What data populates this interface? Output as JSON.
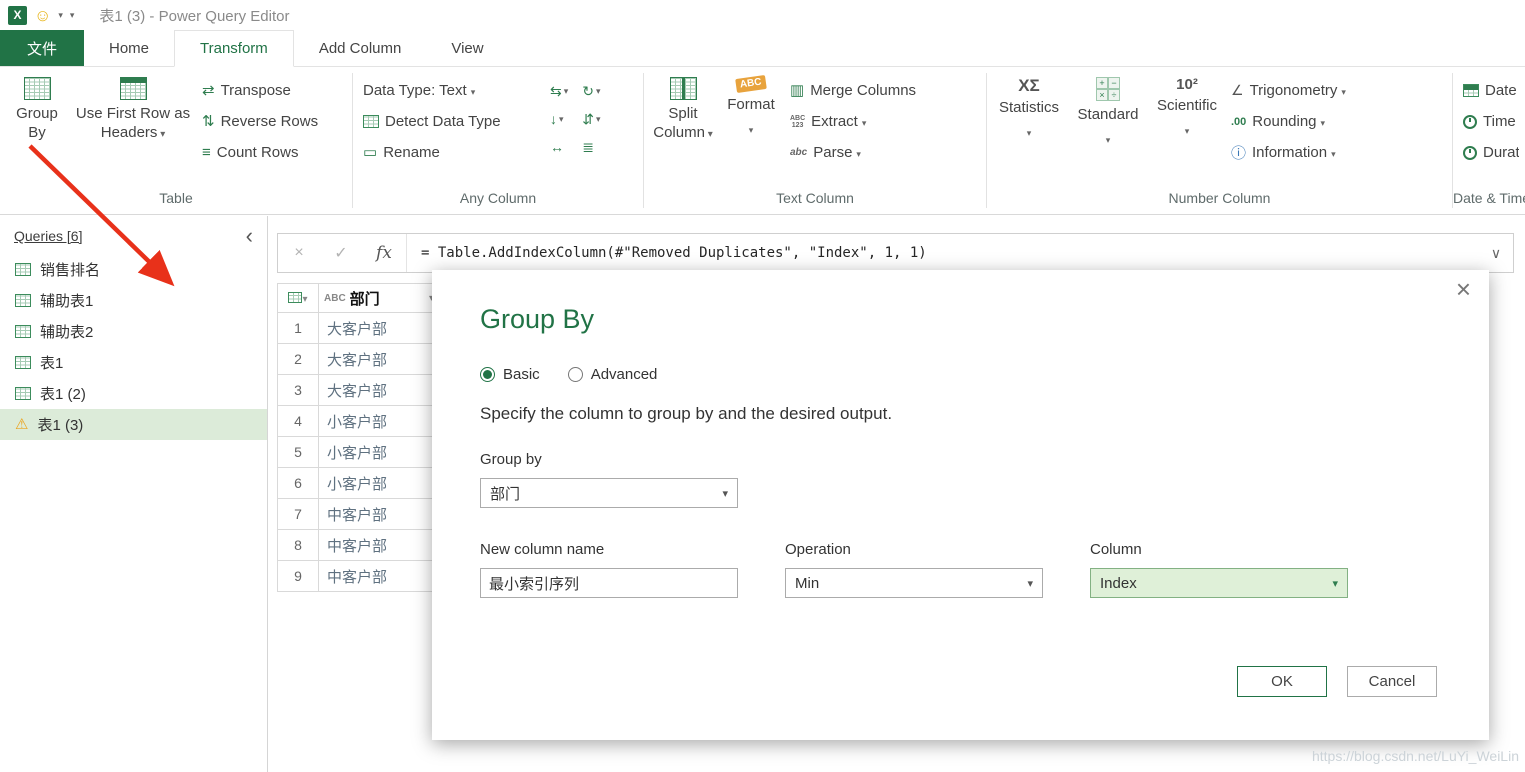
{
  "titlebar": {
    "title": "表1 (3) - Power Query Editor"
  },
  "tabs": {
    "file": "文件",
    "home": "Home",
    "transform": "Transform",
    "add_column": "Add Column",
    "view": "View"
  },
  "ribbon": {
    "table": {
      "label": "Table",
      "group_by": "Group By",
      "use_first_row": "Use First Row as Headers",
      "transpose": "Transpose",
      "reverse_rows": "Reverse Rows",
      "count_rows": "Count Rows"
    },
    "any_column": {
      "label": "Any Column",
      "data_type": "Data Type: Text",
      "detect_data_type": "Detect Data Type",
      "rename": "Rename"
    },
    "text_column": {
      "label": "Text Column",
      "split_column": "Split Column",
      "format": "Format",
      "merge_columns": "Merge Columns",
      "extract": "Extract",
      "parse": "Parse"
    },
    "number_column": {
      "label": "Number Column",
      "statistics": "Statistics",
      "standard": "Standard",
      "scientific": "Scientific",
      "trigonometry": "Trigonometry",
      "rounding": "Rounding",
      "information": "Information"
    },
    "date_time": {
      "label": "Date & Time",
      "date": "Date",
      "time": "Time",
      "duration": "Duration"
    }
  },
  "queries": {
    "header": "Queries [6]",
    "items": [
      {
        "label": "销售排名"
      },
      {
        "label": "辅助表1"
      },
      {
        "label": "辅助表2"
      },
      {
        "label": "表1"
      },
      {
        "label": "表1 (2)"
      },
      {
        "label": "表1 (3)"
      }
    ]
  },
  "formula_bar": {
    "formula": "= Table.AddIndexColumn(#\"Removed Duplicates\", \"Index\", 1, 1)"
  },
  "grid": {
    "column": {
      "type": "ABC",
      "name": "部门"
    },
    "rows": [
      {
        "n": "1",
        "value": "大客户部"
      },
      {
        "n": "2",
        "value": "大客户部"
      },
      {
        "n": "3",
        "value": "大客户部"
      },
      {
        "n": "4",
        "value": "小客户部"
      },
      {
        "n": "5",
        "value": "小客户部"
      },
      {
        "n": "6",
        "value": "小客户部"
      },
      {
        "n": "7",
        "value": "中客户部"
      },
      {
        "n": "8",
        "value": "中客户部"
      },
      {
        "n": "9",
        "value": "中客户部"
      }
    ]
  },
  "dialog": {
    "title": "Group By",
    "basic": "Basic",
    "advanced": "Advanced",
    "description": "Specify the column to group by and the desired output.",
    "group_by_label": "Group by",
    "group_by_value": "部门",
    "new_column_label": "New column name",
    "new_column_value": "最小索引序列",
    "operation_label": "Operation",
    "operation_value": "Min",
    "column_label": "Column",
    "column_value": "Index",
    "ok": "OK",
    "cancel": "Cancel"
  },
  "watermark": "https://blog.csdn.net/LuYi_WeiLin",
  "icons": {
    "excel": "X",
    "smiley": "☺",
    "transpose": "⇄",
    "reverse_rows": "⇅",
    "count_rows": "≡",
    "rename": "▭",
    "merge": "▥",
    "replace_values": "⇆",
    "fill": "↓",
    "pivot": "↻",
    "unpivot": "⇵",
    "move": "↔",
    "to_list": "≣",
    "statistics": "ΧΣ",
    "scientific": "10²",
    "standard_ops": [
      "+",
      "−",
      "×",
      "÷"
    ],
    "trigonometry": "∠",
    "rounding": ".00",
    "information": "ⓘ",
    "extract_top": "ABC",
    "extract_bottom": "123",
    "parse": "abc",
    "format_tag": "ABC",
    "warning": "⚠",
    "cancel_x": "×",
    "check": "✓",
    "fx": "fx",
    "collapse": "‹",
    "expand": "∨",
    "close": "×"
  },
  "colors": {
    "accent": "#217346",
    "selected_row": "#dcebd9",
    "arrow": "#e8311a",
    "warning": "#eca21a"
  }
}
